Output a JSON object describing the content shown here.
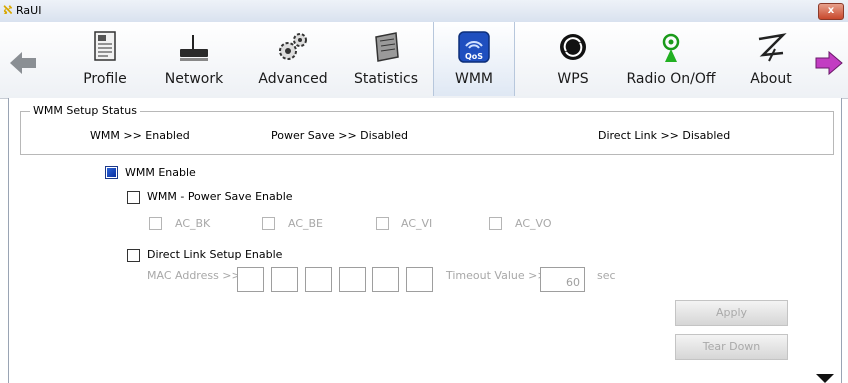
{
  "window": {
    "title": "RaUI",
    "close_label": "x"
  },
  "toolbar": {
    "tabs": [
      {
        "label": "Profile",
        "icon": "profile-icon"
      },
      {
        "label": "Network",
        "icon": "network-icon"
      },
      {
        "label": "Advanced",
        "icon": "advanced-icon"
      },
      {
        "label": "Statistics",
        "icon": "statistics-icon"
      },
      {
        "label": "WMM",
        "icon": "wmm-qos-icon",
        "active": true,
        "icon_text": "QoS"
      },
      {
        "label": "WPS",
        "icon": "wps-icon"
      },
      {
        "label": "Radio On/Off",
        "icon": "radio-icon"
      },
      {
        "label": "About",
        "icon": "about-icon"
      }
    ],
    "back_icon": "left-arrow-icon",
    "forward_icon": "right-arrow-icon"
  },
  "status": {
    "legend": "WMM Setup Status",
    "wmm": "WMM >> Enabled",
    "power_save": "Power Save >> Disabled",
    "direct_link": "Direct Link >> Disabled"
  },
  "options": {
    "wmm_enable": {
      "label": "WMM Enable",
      "checked": true
    },
    "power_save_enable": {
      "label": "WMM - Power Save Enable",
      "checked": false
    },
    "ac": [
      "AC_BK",
      "AC_BE",
      "AC_VI",
      "AC_VO"
    ],
    "direct_link_enable": {
      "label": "Direct Link Setup Enable",
      "checked": false
    },
    "mac_label": "MAC Address >>",
    "timeout_label": "Timeout Value >>",
    "timeout_value": "60",
    "timeout_unit": "sec"
  },
  "buttons": {
    "apply": "Apply",
    "teardown": "Tear Down"
  },
  "colors": {
    "accent": "#1f4fbf",
    "disabled_text": "#a8a8a8"
  }
}
